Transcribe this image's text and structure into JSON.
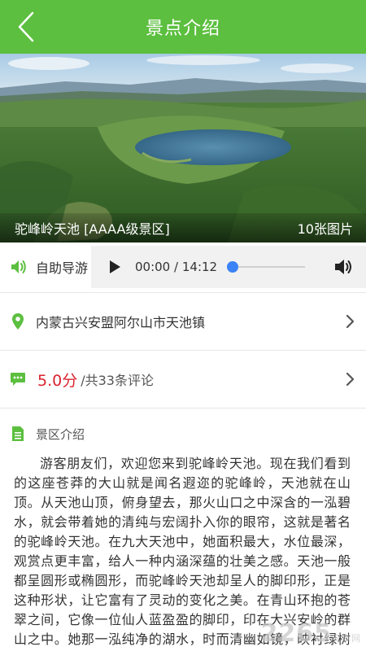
{
  "header": {
    "title": "景点介绍"
  },
  "hero": {
    "caption": "驼峰岭天池 [AAAA级景区]",
    "photo_count": "10张图片"
  },
  "audio": {
    "label": "自助导游",
    "current_time": "00:00",
    "separator": "/",
    "duration": "14:12",
    "progress": 0.0
  },
  "location": {
    "address": "内蒙古兴安盟阿尔山市天池镇"
  },
  "rating": {
    "score": "5.0分",
    "reviews": "/共33条评论"
  },
  "intro": {
    "title": "景区介绍",
    "body": "游客朋友们，欢迎您来到驼峰岭天池。现在我们看到的这座苍莽的大山就是闻名遐迩的驼峰岭，天池就在山顶。从天池山顶，俯身望去，那火山口之中深含的一泓碧水，就会带着她的清纯与宏阔扑入你的眼帘，这就是著名的驼峰岭天池。在九大天池中，她面积最大，水位最深，观赏点更丰富，给人一种内涵深蕴的壮美之感。天池一般都呈圆形或椭圆形，而驼峰岭天池却呈人的脚印形，正是这种形状，让它富有了灵动的变化之美。在青山环抱的苍翠之间，它像一位仙人蓝盈盈的脚印，印在大兴安岭的群山之中。她那一泓纯净的湖水，时而清幽如镜，映衬绿树红花、蓝天白云；时而波弦如丝，弹奏万种柔情，时而"
  },
  "watermark": {
    "text": "2265",
    "sub": "安卓网"
  },
  "colors": {
    "header_green": "#5cbf3f",
    "score_red": "#d9232e",
    "progress_blue": "#3b82f6"
  }
}
